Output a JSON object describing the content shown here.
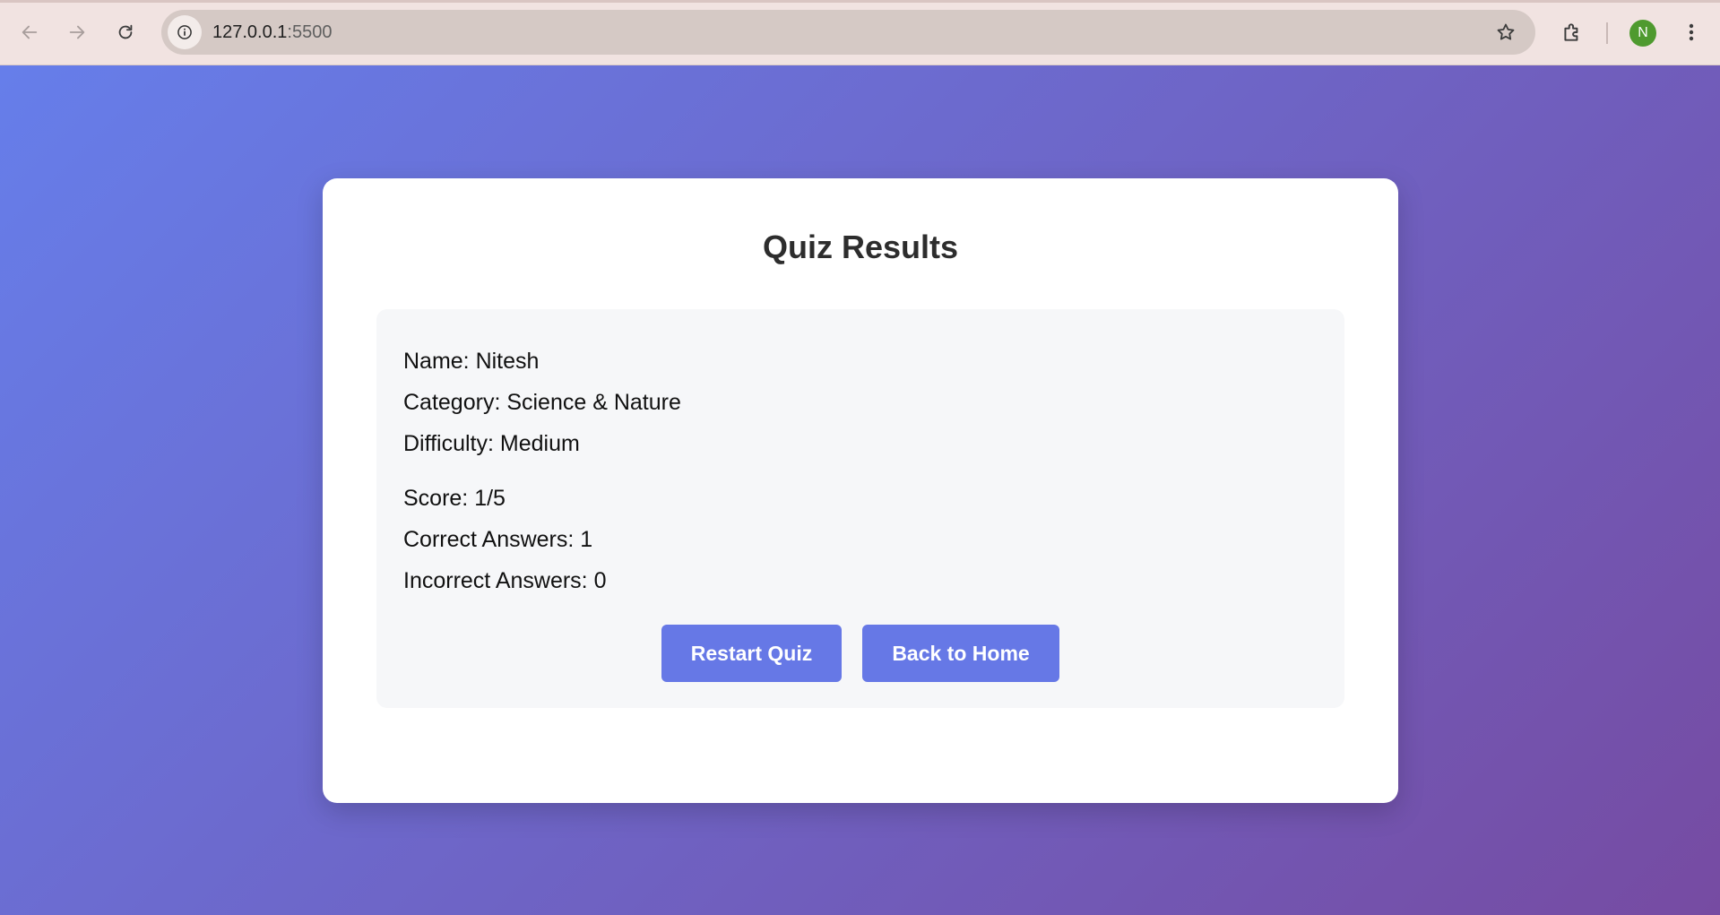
{
  "browser": {
    "url_host": "127.0.0.1",
    "url_port": ":5500",
    "profile_initial": "N"
  },
  "results": {
    "title": "Quiz Results",
    "name_label": "Name: Nitesh",
    "category_label": "Category: Science & Nature",
    "difficulty_label": "Difficulty: Medium",
    "score_label": "Score: 1/5",
    "correct_label": "Correct Answers: 1",
    "incorrect_label": "Incorrect Answers: 0"
  },
  "buttons": {
    "restart_label": "Restart Quiz",
    "home_label": "Back to Home"
  },
  "colors": {
    "gradient_start": "#667eea",
    "gradient_end": "#764ba2",
    "button": "#6678e6",
    "avatar": "#4f9a2f"
  },
  "icons": [
    "back-arrow-icon",
    "forward-arrow-icon",
    "reload-icon",
    "site-info-icon",
    "star-icon",
    "extensions-icon",
    "more-menu-icon"
  ]
}
